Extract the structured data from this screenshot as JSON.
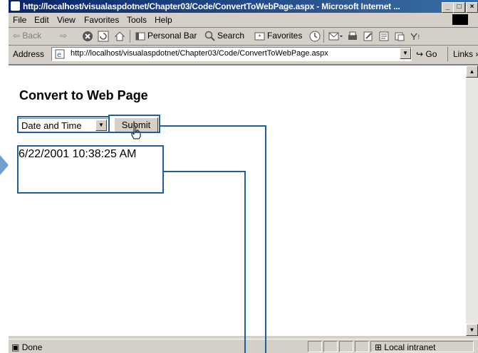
{
  "window": {
    "title": "http://localhost/visualaspdotnet/Chapter03/Code/ConvertToWebPage.aspx - Microsoft Internet ...",
    "controls": {
      "minimize": "_",
      "maximize": "□",
      "close": "×"
    }
  },
  "menu": [
    "File",
    "Edit",
    "View",
    "Favorites",
    "Tools",
    "Help"
  ],
  "toolbar": {
    "back": "⇦ Back",
    "forward": "⇨",
    "personal_bar": "Personal Bar",
    "search": "Search",
    "favorites": "Favorites"
  },
  "address": {
    "label": "Address",
    "url": "http://localhost/visualaspdotnet/Chapter03/Code/ConvertToWebPage.aspx",
    "go": "Go",
    "links": "Links »"
  },
  "page": {
    "title": "Convert to Web Page",
    "select_value": "Date and Time",
    "submit_label": "Submit",
    "output": "6/22/2001 10:38:25 AM"
  },
  "status": {
    "text": "Done",
    "zone": "Local intranet"
  },
  "colors": {
    "titlebar": "#0a246a",
    "chrome": "#d4d0c8",
    "callout": "#1f5f9e"
  }
}
